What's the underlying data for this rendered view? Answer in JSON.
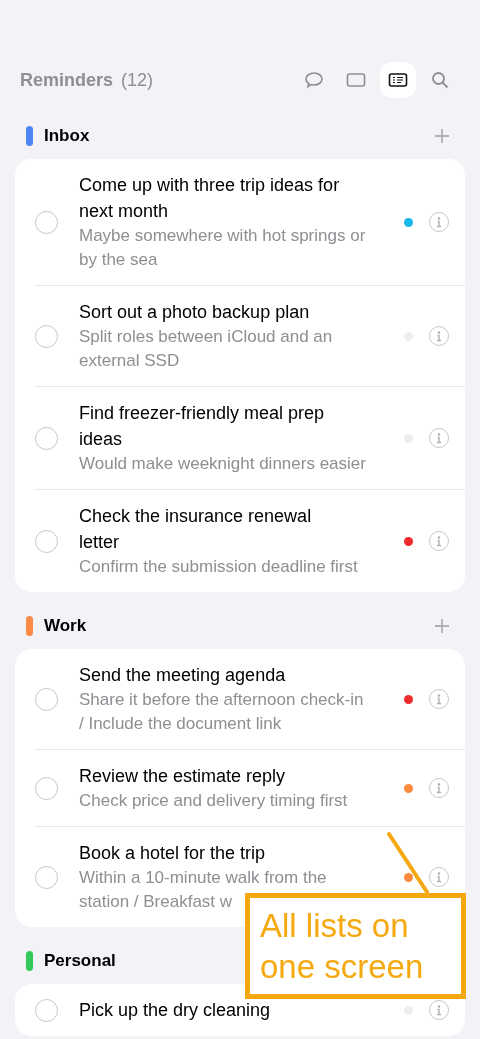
{
  "header": {
    "title": "Reminders",
    "count": "(12)"
  },
  "views": [
    {
      "kind": "chat",
      "selected": false
    },
    {
      "kind": "card",
      "selected": false
    },
    {
      "kind": "list",
      "selected": true
    }
  ],
  "sections": [
    {
      "name": "Inbox",
      "color": "#4f84f7",
      "show_add": true,
      "items": [
        {
          "title": "Come up with three trip ideas for next month",
          "note": "Maybe somewhere with hot springs or by the sea",
          "color": "#1ab8ea"
        },
        {
          "title": "Sort out a photo backup plan",
          "note": "Split roles between iCloud and an external SSD",
          "color": "#eeeeee"
        },
        {
          "title": "Find freezer-friendly meal prep ideas",
          "note": "Would make weeknight dinners easier",
          "color": "#eeeeee"
        },
        {
          "title": "Check the insurance renewal letter",
          "note": "Confirm the submission deadline first",
          "color": "#ee2a2a"
        }
      ]
    },
    {
      "name": "Work",
      "color": "#fb8a44",
      "show_add": true,
      "items": [
        {
          "title": "Send the meeting agenda",
          "note": "Share it before the afternoon check-in / Include the document link",
          "color": "#ee2a2a"
        },
        {
          "title": "Review the estimate reply",
          "note": "Check price and delivery timing first",
          "color": "#fb8a3c"
        },
        {
          "title": "Book a hotel for the trip",
          "note": "Within a 10-minute walk from the station / Breakfast w",
          "color": "#fb8a3c"
        }
      ]
    },
    {
      "name": "Personal",
      "color": "#34c759",
      "items": [
        {
          "title": "Pick up the dry cleaning",
          "color": "#eeeeee"
        }
      ]
    }
  ],
  "callout": {
    "text": "All lists on one screen"
  }
}
